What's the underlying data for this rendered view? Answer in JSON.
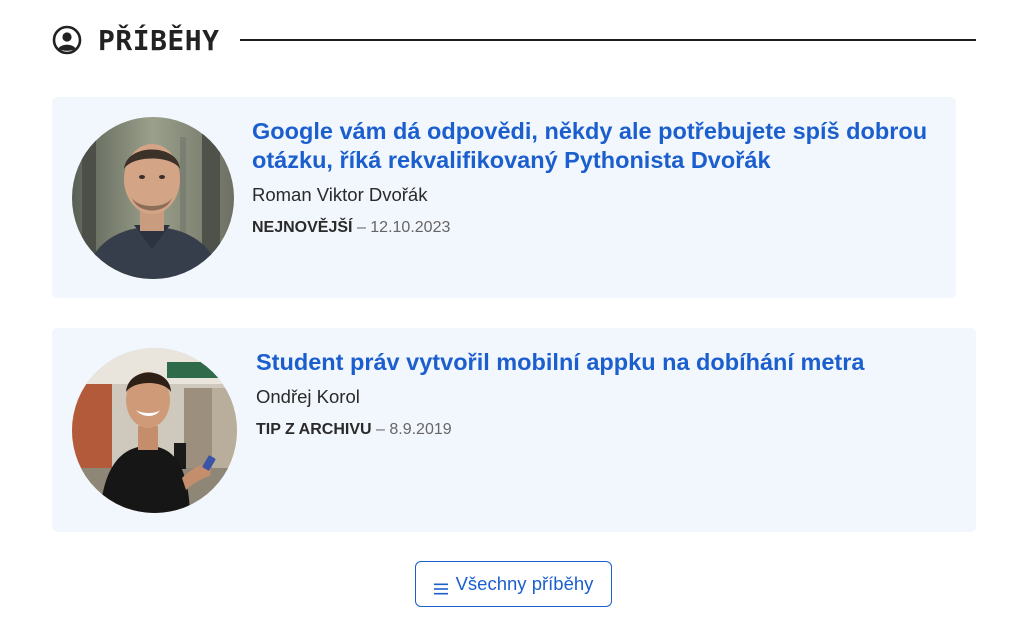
{
  "section": {
    "icon": "user-circle-icon",
    "title": "PŘÍBĚHY"
  },
  "stories": [
    {
      "title": "Google vám dá odpovědi, někdy ale potřebujete spíš dobrou otázku, říká rekvalifikovaný Pythonista Dvořák",
      "author": "Roman Viktor Dvořák",
      "tag": "NEJNOVĚJŠÍ",
      "date": "– 12.10.2023",
      "avatar": "portrait-photo"
    },
    {
      "title": "Student práv vytvořil mobilní appku na dobíhání metra",
      "author": "Ondřej Korol",
      "tag": "TIP Z ARCHIVU",
      "date": "– 8.9.2019",
      "avatar": "portrait-photo"
    }
  ],
  "all_button": {
    "icon": "menu-lines-icon",
    "label": "Všechny příběhy"
  },
  "colors": {
    "accent": "#1b5fce",
    "card_bg": "#f2f6fd",
    "text": "#222222"
  }
}
